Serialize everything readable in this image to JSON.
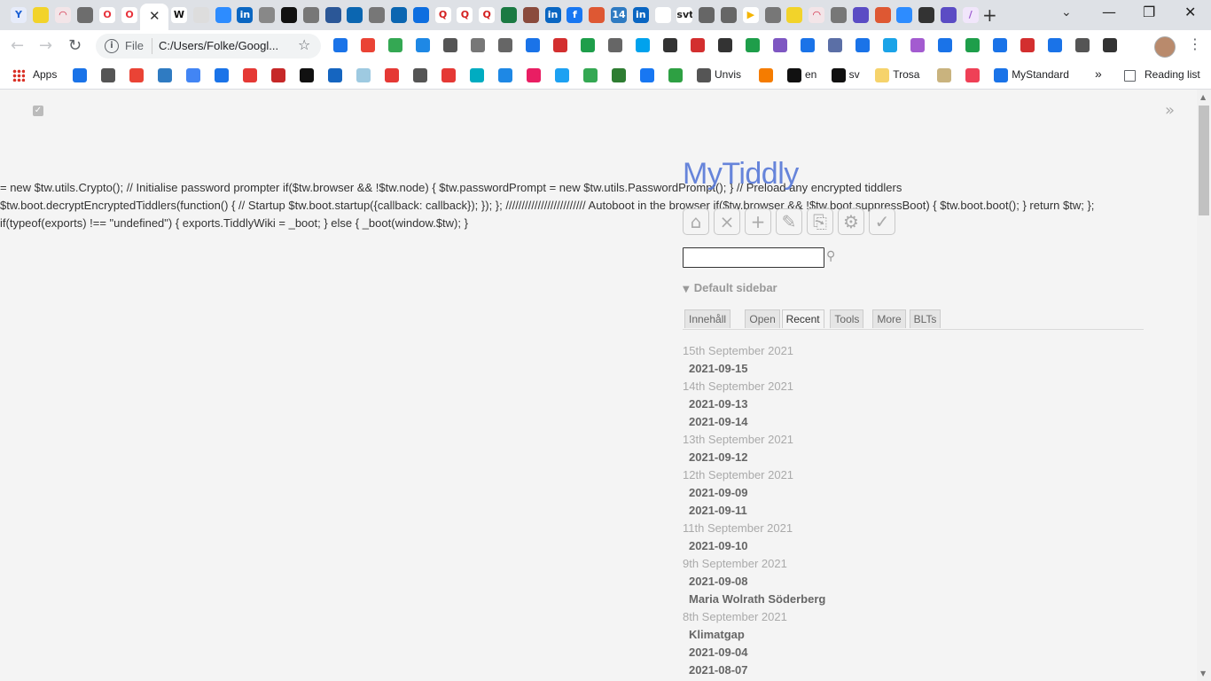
{
  "browser": {
    "tab_favicons": [
      {
        "glyph": "Y",
        "color": "#1a5fd4",
        "bg": "#e7ecfa"
      },
      {
        "glyph": "",
        "color": "#222",
        "bg": "#f2d32a"
      },
      {
        "glyph": "◠",
        "color": "#d1223e",
        "bg": "#f3e5e8"
      },
      {
        "glyph": "",
        "color": "#555",
        "bg": "#6d6d6d"
      },
      {
        "glyph": "O",
        "color": "#e8333c",
        "bg": "#fff"
      },
      {
        "glyph": "O",
        "color": "#e8333c",
        "bg": "#fff"
      }
    ],
    "active_tab_close": "✕",
    "tab_favicons_right": [
      {
        "glyph": "W",
        "color": "#111",
        "bg": "#fff"
      },
      {
        "glyph": "",
        "color": "#555",
        "bg": "#ddd"
      },
      {
        "glyph": "",
        "color": "#fff",
        "bg": "#2d8cff"
      },
      {
        "glyph": "in",
        "color": "#fff",
        "bg": "#0a66c2"
      },
      {
        "glyph": "",
        "color": "#333",
        "bg": "#888"
      },
      {
        "glyph": "",
        "color": "#fff",
        "bg": "#111"
      },
      {
        "glyph": "",
        "color": "#fff",
        "bg": "#777"
      },
      {
        "glyph": "",
        "color": "#fff",
        "bg": "#2b5797"
      },
      {
        "glyph": "",
        "color": "#fff",
        "bg": "#0b66b1"
      },
      {
        "glyph": "",
        "color": "#fff",
        "bg": "#777"
      },
      {
        "glyph": "",
        "color": "#fff",
        "bg": "#0b66b1"
      },
      {
        "glyph": "",
        "color": "#fff",
        "bg": "#0d6ee0"
      },
      {
        "glyph": "Q",
        "color": "#d42020",
        "bg": "#fff"
      },
      {
        "glyph": "Q",
        "color": "#d42020",
        "bg": "#fff"
      },
      {
        "glyph": "Q",
        "color": "#d42020",
        "bg": "#fff"
      },
      {
        "glyph": "",
        "color": "#fff",
        "bg": "#1b7a43"
      },
      {
        "glyph": "",
        "color": "#fff",
        "bg": "#8a4b3d"
      },
      {
        "glyph": "in",
        "color": "#fff",
        "bg": "#0a66c2"
      },
      {
        "glyph": "f",
        "color": "#fff",
        "bg": "#1877f2"
      },
      {
        "glyph": "",
        "color": "#fff",
        "bg": "#de5833"
      },
      {
        "glyph": "14",
        "color": "#fff",
        "bg": "#2f7bc2"
      },
      {
        "glyph": "in",
        "color": "#fff",
        "bg": "#0a66c2"
      },
      {
        "glyph": "",
        "color": "#1a73e8",
        "bg": "#fff"
      },
      {
        "glyph": "svt",
        "color": "#222",
        "bg": "#fff"
      },
      {
        "glyph": "",
        "color": "#fff",
        "bg": "#666"
      },
      {
        "glyph": "",
        "color": "#fff",
        "bg": "#666"
      },
      {
        "glyph": "▶",
        "color": "#f4b400",
        "bg": "#fff"
      },
      {
        "glyph": "",
        "color": "#fff",
        "bg": "#777"
      },
      {
        "glyph": "",
        "color": "#222",
        "bg": "#f2d32a"
      },
      {
        "glyph": "◠",
        "color": "#d1223e",
        "bg": "#f3e5e8"
      },
      {
        "glyph": "",
        "color": "#fff",
        "bg": "#777"
      },
      {
        "glyph": "",
        "color": "#fff",
        "bg": "#5b4cc4"
      },
      {
        "glyph": "",
        "color": "#fff",
        "bg": "#de5833"
      },
      {
        "glyph": "",
        "color": "#fff",
        "bg": "#2d8cff"
      },
      {
        "glyph": "",
        "color": "#fff",
        "bg": "#333"
      },
      {
        "glyph": "",
        "color": "#fff",
        "bg": "#5b4cc4"
      },
      {
        "glyph": "/",
        "color": "#9b59d0",
        "bg": "#f1e6fb"
      }
    ],
    "new_tab": "+",
    "tab_search": "⌄",
    "window_controls": {
      "minimize": "—",
      "restore": "❐",
      "close": "✕"
    },
    "nav": {
      "back": "←",
      "forward": "→",
      "reload": "↻"
    },
    "omnibox": {
      "info": "i",
      "scheme": "File",
      "url": "C:/Users/Folke/Googl...",
      "star": "☆"
    },
    "extensions": [
      "#1a73e8",
      "#ea4335",
      "#34a853",
      "#1e88e5",
      "#555555",
      "#777777",
      "#666666",
      "#1a73e8",
      "#d32f2f",
      "#1e9e4a",
      "#666666",
      "#00a2ed",
      "#333333",
      "#d32f2f",
      "#333333",
      "#1e9e4a",
      "#7e57c2",
      "#1a73e8",
      "#5b6fa6",
      "#1a73e8",
      "#1aa3e8",
      "#a35bd0",
      "#1a73e8",
      "#1e9e4a",
      "#1a73e8",
      "#d32f2f",
      "#1a73e8",
      "#555555",
      "#333333"
    ],
    "menu": "⋮",
    "bookmarks": [
      {
        "label": "Apps",
        "color": "#d93025"
      },
      {
        "label": "",
        "color": "#1a73e8"
      },
      {
        "label": "",
        "color": "#555"
      },
      {
        "label": "",
        "color": "#ea4335"
      },
      {
        "label": "",
        "color": "#2f7bc2"
      },
      {
        "label": "",
        "color": "#4285f4"
      },
      {
        "label": "",
        "color": "#1a73e8"
      },
      {
        "label": "",
        "color": "#e53935"
      },
      {
        "label": "",
        "color": "#c62828"
      },
      {
        "label": "",
        "color": "#111"
      },
      {
        "label": "",
        "color": "#1565c0"
      },
      {
        "label": "",
        "color": "#9ecae1"
      },
      {
        "label": "",
        "color": "#e53935"
      },
      {
        "label": "",
        "color": "#555"
      },
      {
        "label": "",
        "color": "#e53935"
      },
      {
        "label": "",
        "color": "#00acc1"
      },
      {
        "label": "",
        "color": "#1e88e5"
      },
      {
        "label": "",
        "color": "#e91e63"
      },
      {
        "label": "",
        "color": "#1da1f2"
      },
      {
        "label": "",
        "color": "#34a853"
      },
      {
        "label": "",
        "color": "#2e7d32"
      },
      {
        "label": "",
        "color": "#1877f2"
      },
      {
        "label": "",
        "color": "#2ea043"
      },
      {
        "label": "Unvis",
        "color": "#555"
      },
      {
        "label": "",
        "color": "#f57c00"
      },
      {
        "label": "en",
        "color": "#111"
      },
      {
        "label": "sv",
        "color": "#111"
      },
      {
        "label": "Trosa",
        "color": "#f6d36b"
      },
      {
        "label": "",
        "color": "#c9b37e"
      },
      {
        "label": "",
        "color": "#ef4056"
      },
      {
        "label": "MyStandard",
        "color": "#1a73e8"
      }
    ],
    "bookmarks_overflow": "»",
    "reading_list": "Reading list"
  },
  "page": {
    "code_lines": [
      "= new $tw.utils.Crypto(); // Initialise password prompter if($tw.browser && !$tw.node) { $tw.passwordPrompt = new $tw.utils.PasswordPrompt(); } // Preload any encrypted tiddlers",
      "$tw.boot.decryptEncryptedTiddlers(function() { // Startup $tw.boot.startup({callback: callback}); }); }; ///////////////////////// Autoboot in the browser if($tw.browser && !$tw.boot.suppressBoot) { $tw.boot.boot(); } return $tw; };",
      "if(typeof(exports) !== \"undefined\") { exports.TiddlyWiki = _boot; } else { _boot(window.$tw); }"
    ],
    "site_title": "MyTiddly",
    "sidebar_buttons": [
      {
        "name": "home-icon",
        "glyph": "⌂"
      },
      {
        "name": "close-all-icon",
        "glyph": "⨯"
      },
      {
        "name": "new-tiddler-icon",
        "glyph": "+"
      },
      {
        "name": "new-journal-icon",
        "glyph": "✎"
      },
      {
        "name": "import-icon",
        "glyph": "⎘"
      },
      {
        "name": "control-panel-icon",
        "glyph": "⚙"
      },
      {
        "name": "save-wiki-icon",
        "glyph": "✓"
      }
    ],
    "search_icon": "⚲",
    "default_sidebar_label": "Default sidebar",
    "sidebar_tabs": [
      "Innehåll",
      "Open",
      "Recent",
      "Tools",
      "More",
      "BLTs"
    ],
    "active_tab": "Recent",
    "recent": [
      {
        "date": "15th September 2021",
        "entries": [
          "2021-09-15"
        ]
      },
      {
        "date": "14th September 2021",
        "entries": [
          "2021-09-13",
          "2021-09-14"
        ]
      },
      {
        "date": "13th September 2021",
        "entries": [
          "2021-09-12"
        ]
      },
      {
        "date": "12th September 2021",
        "entries": [
          "2021-09-09",
          "2021-09-11"
        ]
      },
      {
        "date": "11th September 2021",
        "entries": [
          "2021-09-10"
        ]
      },
      {
        "date": "9th September 2021",
        "entries": [
          "2021-09-08",
          "Maria Wolrath Söderberg"
        ]
      },
      {
        "date": "8th September 2021",
        "entries": [
          "Klimatgap",
          "2021-09-04",
          "2021-08-07"
        ]
      }
    ]
  }
}
